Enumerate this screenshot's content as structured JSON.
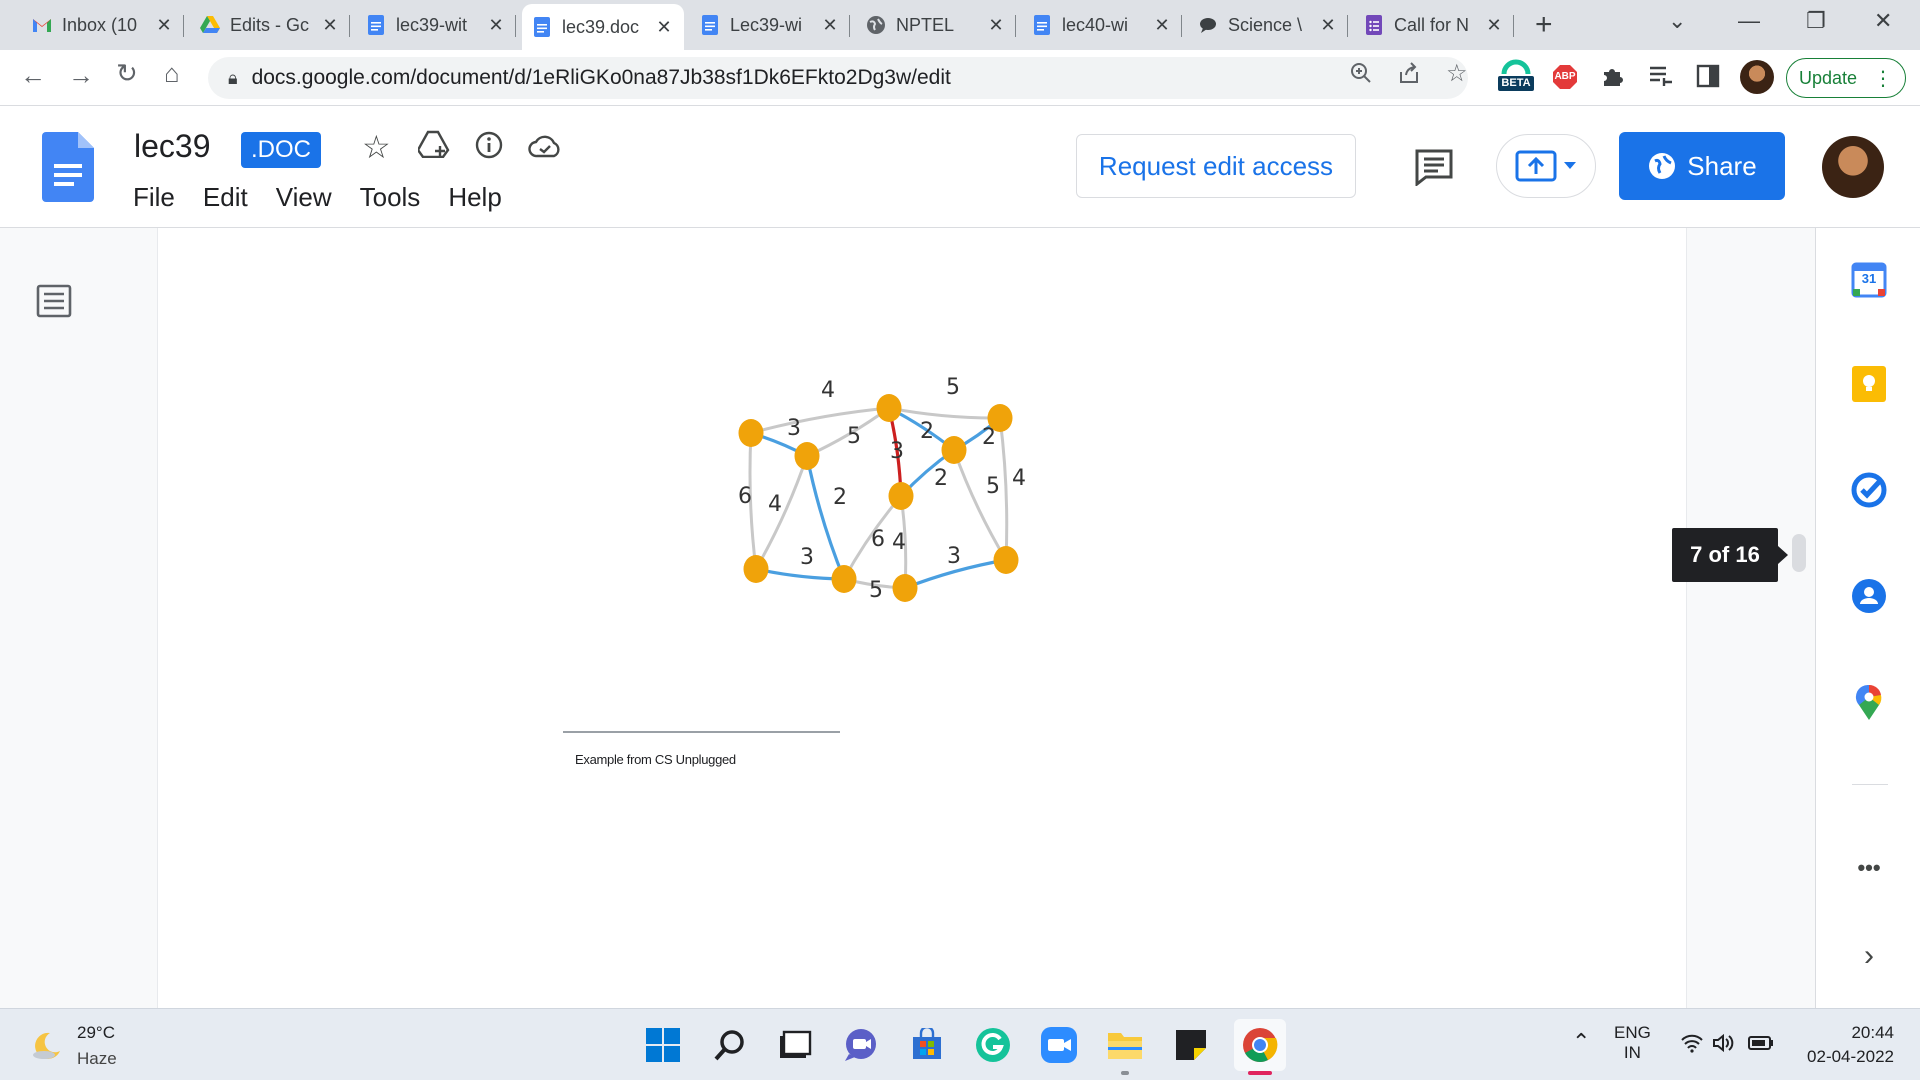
{
  "browser": {
    "tabs": [
      {
        "title": "Inbox (10",
        "icon": "gmail-icon"
      },
      {
        "title": "Edits - Gc",
        "icon": "drive-icon"
      },
      {
        "title": "lec39-wit",
        "icon": "docs-icon"
      },
      {
        "title": "lec39.doc",
        "icon": "docs-icon"
      },
      {
        "title": "Lec39-wi",
        "icon": "docs-icon"
      },
      {
        "title": "NPTEL",
        "icon": "globe-icon"
      },
      {
        "title": "lec40-wi",
        "icon": "docs-icon"
      },
      {
        "title": "Science \\",
        "icon": "chat-icon"
      },
      {
        "title": "Call for N",
        "icon": "forms-icon"
      }
    ],
    "url": "docs.google.com/document/d/1eRliGKo0na87Jb38sf1Dk6EFkto2Dg3w/edit",
    "update_label": "Update",
    "beta_label": "BETA",
    "abp_label": "ABP"
  },
  "docs": {
    "title": "lec39",
    "badge": ".DOC",
    "menu": [
      "File",
      "Edit",
      "View",
      "Tools",
      "Help"
    ],
    "request_edit": "Request edit access",
    "share": "Share"
  },
  "document": {
    "footnote": "Example from CS Unplugged",
    "page_indicator": "7 of 16"
  },
  "graph": {
    "edge_labels": [
      "4",
      "5",
      "3",
      "5",
      "2",
      "2",
      "3",
      "6",
      "4",
      "2",
      "2",
      "5",
      "4",
      "6",
      "4",
      "3",
      "3",
      "5"
    ],
    "colors": {
      "node": "#f0a30a",
      "mst_edge": "#4a9fe0",
      "highlight_edge": "#cc1f1f",
      "other_edge": "#c8c8c8"
    }
  },
  "sidepanel": {
    "calendar_day": "31",
    "icons": [
      "calendar-icon",
      "keep-icon",
      "tasks-icon",
      "contacts-icon",
      "maps-icon",
      "more-icon",
      "expand-icon"
    ]
  },
  "taskbar": {
    "temperature": "29°C",
    "weather": "Haze",
    "lang_line1": "ENG",
    "lang_line2": "IN",
    "time": "20:44",
    "date": "02-04-2022"
  }
}
